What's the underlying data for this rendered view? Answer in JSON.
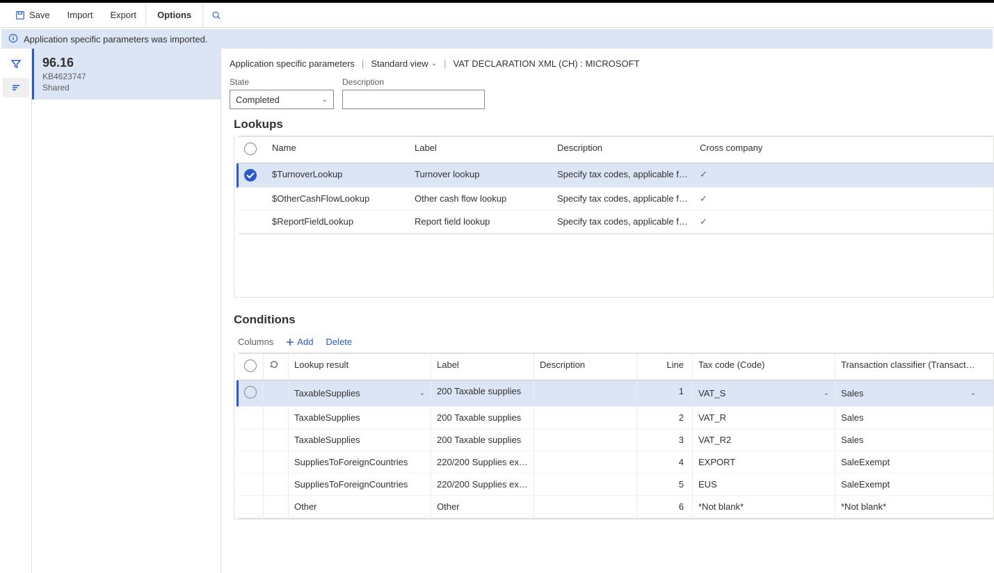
{
  "toolbar": {
    "save": "Save",
    "import": "Import",
    "export": "Export",
    "options": "Options"
  },
  "notification": "Application specific parameters was imported.",
  "sidebar_item": {
    "version": "96.16",
    "kb": "KB4623747",
    "scope": "Shared"
  },
  "breadcrumb": {
    "page": "Application specific parameters",
    "view": "Standard view",
    "context": "VAT DECLARATION XML (CH) : MICROSOFT"
  },
  "form": {
    "state_label": "State",
    "state_value": "Completed",
    "description_label": "Description",
    "description_value": ""
  },
  "lookups": {
    "title": "Lookups",
    "headers": {
      "name": "Name",
      "label": "Label",
      "description": "Description",
      "cross": "Cross company"
    },
    "rows": [
      {
        "name": "$TurnoverLookup",
        "label": "Turnover lookup",
        "description": "Specify tax codes, applicable for...",
        "cross": true,
        "selected": true
      },
      {
        "name": "$OtherCashFlowLookup",
        "label": "Other cash flow lookup",
        "description": "Specify tax codes, applicable for...",
        "cross": true,
        "selected": false
      },
      {
        "name": "$ReportFieldLookup",
        "label": "Report field lookup",
        "description": "Specify tax codes, applicable for...",
        "cross": true,
        "selected": false
      }
    ]
  },
  "conditions": {
    "title": "Conditions",
    "toolbar": {
      "columns": "Columns",
      "add": "Add",
      "delete": "Delete"
    },
    "headers": {
      "result": "Lookup result",
      "label": "Label",
      "description": "Description",
      "line": "Line",
      "tax": "Tax code (Code)",
      "txclass": "Transaction classifier (TransactionCla..."
    },
    "rows": [
      {
        "result": "TaxableSupplies",
        "label": "200 Taxable supplies",
        "description": "",
        "line": 1,
        "tax": "VAT_S",
        "txclass": "Sales",
        "selected": true
      },
      {
        "result": "TaxableSupplies",
        "label": "200 Taxable supplies",
        "description": "",
        "line": 2,
        "tax": "VAT_R",
        "txclass": "Sales",
        "selected": false
      },
      {
        "result": "TaxableSupplies",
        "label": "200 Taxable supplies",
        "description": "",
        "line": 3,
        "tax": "VAT_R2",
        "txclass": "Sales",
        "selected": false
      },
      {
        "result": "SuppliesToForeignCountries",
        "label": "220/200 Supplies exe...",
        "description": "",
        "line": 4,
        "tax": "EXPORT",
        "txclass": "SaleExempt",
        "selected": false
      },
      {
        "result": "SuppliesToForeignCountries",
        "label": "220/200 Supplies exe...",
        "description": "",
        "line": 5,
        "tax": "EUS",
        "txclass": "SaleExempt",
        "selected": false
      },
      {
        "result": "Other",
        "label": "Other",
        "description": "",
        "line": 6,
        "tax": "*Not blank*",
        "txclass": "*Not blank*",
        "selected": false
      }
    ]
  }
}
